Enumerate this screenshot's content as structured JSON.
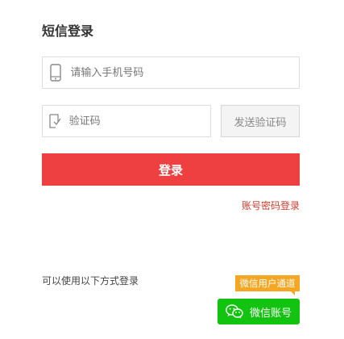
{
  "form": {
    "title": "短信登录",
    "phone": {
      "placeholder": "请输入手机号码",
      "icon": "phone-icon"
    },
    "code": {
      "placeholder": "验证码",
      "icon": "verify-code-icon"
    },
    "send_code_label": "发送验证码",
    "login_label": "登录",
    "account_login_link": "账号密码登录"
  },
  "other_login": {
    "label": "可以使用以下方式登录",
    "wechat_badge": "微信用户通道",
    "wechat_button_label": "微信账号",
    "wechat_icon": "wechat-icon"
  },
  "colors": {
    "login_button": "#ee4040",
    "link": "#d33a2c",
    "badge": "#f5a623",
    "wechat": "#12c30f"
  }
}
